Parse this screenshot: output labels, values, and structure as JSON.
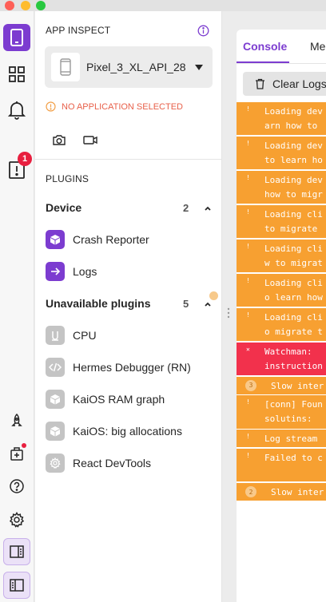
{
  "colors": {
    "accent": "#7c3cd0",
    "warning": "#f7a031",
    "error": "#f2314c",
    "badge": "#e81f3f",
    "no_app": "#e8604a"
  },
  "rail": {
    "top_icons": [
      "device-icon",
      "grid-icon",
      "bell-icon",
      "alert-icon"
    ],
    "alert_badge": "1",
    "bottom_icons": [
      "rocket-icon",
      "plugin-manager-icon",
      "help-icon",
      "settings-icon",
      "toggle-left-sidebar-icon",
      "toggle-right-sidebar-icon"
    ]
  },
  "sidebar": {
    "title": "APP INSPECT",
    "device": "Pixel_3_XL_API_28",
    "no_app": "NO APPLICATION SELECTED",
    "plugins_heading": "PLUGINS",
    "device_section": {
      "title": "Device",
      "count": "2",
      "items": [
        "Crash Reporter",
        "Logs"
      ]
    },
    "unavailable_section": {
      "title": "Unavailable plugins",
      "count": "5",
      "items": [
        "CPU",
        "Hermes Debugger (RN)",
        "KaiOS RAM graph",
        "KaiOS: big allocations",
        "React DevTools"
      ]
    }
  },
  "console": {
    "tabs": [
      "Console",
      "Me"
    ],
    "clear_label": "Clear Logs",
    "logs": [
      {
        "level": "warn",
        "lines": [
          "Loading dev",
          "arn how to "
        ]
      },
      {
        "level": "warn",
        "lines": [
          "Loading dev",
          "to learn ho"
        ]
      },
      {
        "level": "warn",
        "lines": [
          "Loading dev",
          "how to migr"
        ]
      },
      {
        "level": "warn",
        "lines": [
          "Loading cli",
          "to migrate "
        ]
      },
      {
        "level": "warn",
        "lines": [
          "Loading cli",
          "w to migrat"
        ]
      },
      {
        "level": "warn",
        "lines": [
          "Loading cli",
          "o learn how"
        ]
      },
      {
        "level": "warn",
        "lines": [
          "Loading cli",
          "o migrate t"
        ]
      },
      {
        "level": "error",
        "lines": [
          "Watchman: ",
          "instruction"
        ]
      },
      {
        "level": "warn",
        "count": "3",
        "lines": [
          "Slow inter"
        ]
      },
      {
        "level": "warn",
        "lines": [
          "[conn] Foun",
          "solutins: "
        ]
      },
      {
        "level": "warn",
        "lines": [
          "Log stream "
        ]
      },
      {
        "level": "warn",
        "lines": [
          "Failed to c",
          ""
        ]
      },
      {
        "level": "warn",
        "count": "2",
        "lines": [
          "Slow inter"
        ]
      }
    ]
  }
}
